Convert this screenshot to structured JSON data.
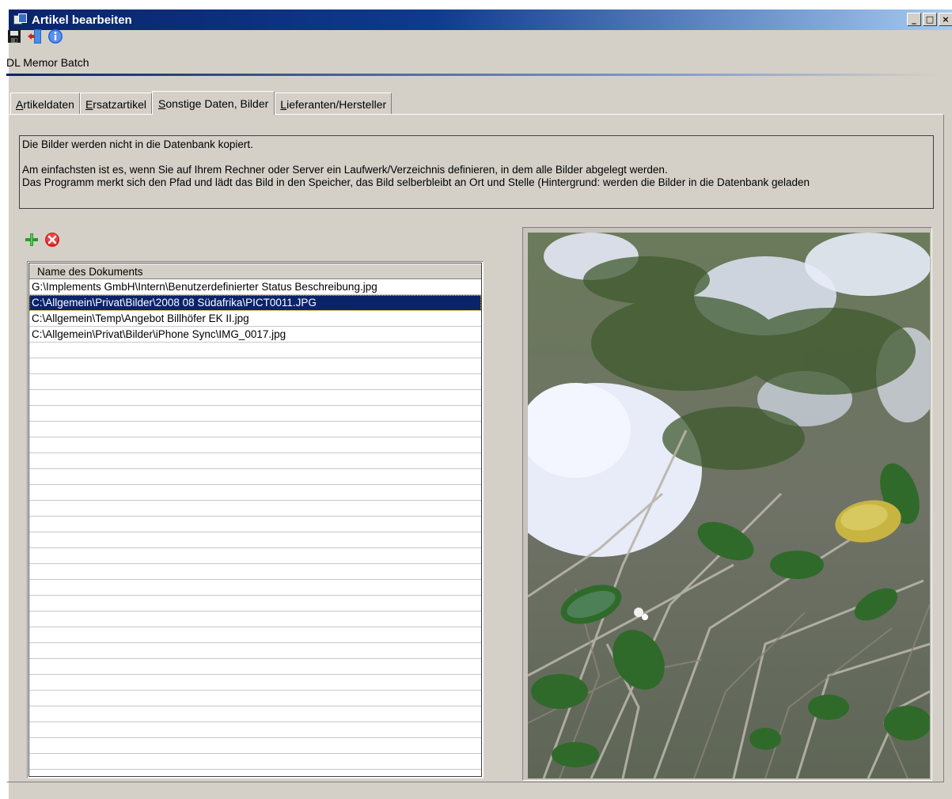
{
  "window": {
    "title": "Artikel bearbeiten",
    "controls": [
      "_",
      "□",
      "×"
    ]
  },
  "toolbar": {
    "icons": [
      "save-icon",
      "exit-icon",
      "info-icon"
    ]
  },
  "record_label": "DL Memor Batch",
  "tabs": [
    {
      "pre": "",
      "key": "A",
      "post": "rtikeldaten",
      "active": false
    },
    {
      "pre": "",
      "key": "E",
      "post": "rsatzartikel",
      "active": false
    },
    {
      "pre": "",
      "key": "S",
      "post": "onstige Daten, Bilder",
      "active": true
    },
    {
      "pre": "",
      "key": "L",
      "post": "ieferanten/Hersteller",
      "active": false
    }
  ],
  "info": {
    "line1": "Die Bilder werden nicht in die Datenbank kopiert.",
    "line2": "Am einfachsten ist es, wenn Sie auf Ihrem Rechner oder Server ein Laufwerk/Verzeichnis definieren, in dem alle Bilder abgelegt werden.",
    "line3": "Das Programm merkt sich den Pfad und lädt das Bild in den Speicher, das Bild selberbleibt an Ort und Stelle (Hintergrund: werden die Bilder in die Datenbank geladen"
  },
  "list_tools": {
    "add_color": "#2a9a2a",
    "delete_color": "#d42020"
  },
  "documents": {
    "column_header": "Name des Dokuments",
    "rows": [
      "G:\\Implements GmbH\\Intern\\Benutzerdefinierter Status Beschreibung.jpg",
      "C:\\Allgemein\\Privat\\Bilder\\2008 08 Südafrika\\PICT0011.JPG",
      "C:\\Allgemein\\Temp\\Angebot Billhöfer EK II.jpg",
      "C:\\Allgemein\\Privat\\Bilder\\iPhone Sync\\IMG_0017.jpg"
    ],
    "selected_index": 1
  },
  "colors": {
    "title_bar": "#0a246a",
    "selection": "#0a246a",
    "window_bg": "#d4d0c8"
  }
}
